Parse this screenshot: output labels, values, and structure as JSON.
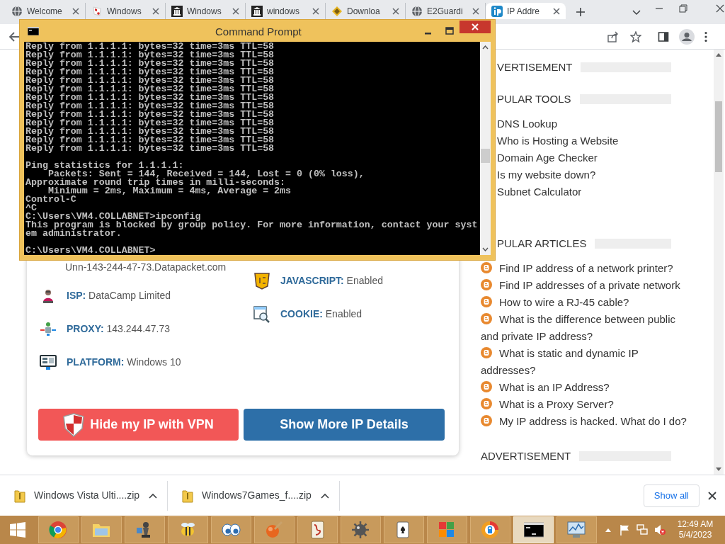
{
  "browser": {
    "tabs": [
      {
        "title": "Welcome",
        "kind": "globe",
        "selected": false
      },
      {
        "title": "Windows",
        "kind": "flag",
        "selected": false
      },
      {
        "title": "Windows",
        "kind": "building",
        "selected": false
      },
      {
        "title": "windows",
        "kind": "building",
        "selected": false
      },
      {
        "title": "Downloa",
        "kind": "diamond",
        "selected": false
      },
      {
        "title": "E2Guardi",
        "kind": "globe",
        "selected": false
      },
      {
        "title": "IP Addre",
        "kind": "logo",
        "selected": true
      }
    ]
  },
  "console": {
    "title": "Command Prompt",
    "lines": [
      {
        "text": "Reply from 1.1.1.1: bytes=32 time=3ms TTL=58"
      },
      {
        "text": "Reply from 1.1.1.1: bytes=32 time=3ms TTL=58"
      },
      {
        "text": "Reply from 1.1.1.1: bytes=32 time=3ms TTL=58"
      },
      {
        "text": "Reply from 1.1.1.1: bytes=32 time=3ms TTL=58"
      },
      {
        "text": "Reply from 1.1.1.1: bytes=32 time=3ms TTL=58"
      },
      {
        "text": "Reply from 1.1.1.1: bytes=32 time=3ms TTL=58"
      },
      {
        "text": "Reply from 1.1.1.1: bytes=32 time=3ms TTL=58"
      },
      {
        "text": "Reply from 1.1.1.1: bytes=32 time=3ms TTL=58"
      },
      {
        "text": "Reply from 1.1.1.1: bytes=32 time=3ms TTL=58"
      },
      {
        "text": "Reply from 1.1.1.1: bytes=32 time=3ms TTL=58"
      },
      {
        "text": "Reply from 1.1.1.1: bytes=32 time=3ms TTL=58"
      },
      {
        "text": "Reply from 1.1.1.1: bytes=32 time=3ms TTL=58"
      },
      {
        "text": "Reply from 1.1.1.1: bytes=32 time=3ms TTL=58"
      },
      {
        "text": "Ping statistics for 1.1.1.1:",
        "gap_before": true
      },
      {
        "text": "    Packets: Sent = 144, Received = 144, Lost = 0 (0% loss),"
      },
      {
        "text": "Approximate round trip times in milli-seconds:"
      },
      {
        "text": "    Minimum = 2ms, Maximum = 4ms, Average = 2ms"
      },
      {
        "text": "Control-C"
      },
      {
        "text": "^C"
      },
      {
        "text": "C:\\Users\\VM4.COLLABNET>ipconfig"
      },
      {
        "text": "This program is blocked by group policy. For more information, contact your syst"
      },
      {
        "text": "em administrator."
      },
      {
        "text": "C:\\Users\\VM4.COLLABNET>",
        "gap_before": true
      }
    ]
  },
  "page": {
    "hostname": "Unn-143-244-47-73.Datapacket.com",
    "info_left": [
      {
        "label": "ISP:",
        "value": "DataCamp Limited",
        "kind": "person"
      },
      {
        "label": "PROXY:",
        "value": "143.244.47.73",
        "kind": "network"
      },
      {
        "label": "PLATFORM:",
        "value": "Windows 10",
        "kind": "monitor"
      }
    ],
    "info_right": [
      {
        "label": "JAVASCRIPT:",
        "value": "Enabled",
        "kind": "js"
      },
      {
        "label": "COOKIE:",
        "value": "Enabled",
        "kind": "magnifier"
      }
    ],
    "buttons": [
      {
        "label": "Hide my IP with VPN",
        "kind": "vpn"
      },
      {
        "label": "Show More IP Details",
        "kind": "details"
      }
    ]
  },
  "sidebar": {
    "sections": [
      {
        "heading": "VERTISEMENT",
        "kind": "ad"
      },
      {
        "heading": "PULAR TOOLS",
        "kind": "tools",
        "items": [
          "DNS Lookup",
          "Who is Hosting a Website",
          "Domain Age Checker",
          "Is my website down?",
          "Subnet Calculator"
        ]
      },
      {
        "heading": "PULAR ARTICLES",
        "kind": "articles",
        "items": [
          "Find IP address of a network printer?",
          "Find IP addresses of a private network",
          "How to wire a RJ-45 cable?",
          "What is the difference between public and private IP address?",
          "What is static and dynamic IP addresses?",
          "What is an IP Address?",
          "What is a Proxy Server?",
          "My IP address is hacked. What do I do?"
        ]
      },
      {
        "heading": "ADVERTISEMENT",
        "kind": "ad"
      }
    ]
  },
  "downloads": {
    "items": [
      "Windows Vista Ulti....zip",
      "Windows7Games_f....zip"
    ],
    "show_all": "Show all"
  },
  "taskbar": {
    "apps": [
      {
        "kind": "browser",
        "selected": false
      },
      {
        "kind": "folder",
        "selected": false
      },
      {
        "kind": "chess",
        "selected": false
      },
      {
        "kind": "bee",
        "selected": false
      },
      {
        "kind": "eyes",
        "selected": false
      },
      {
        "kind": "paint",
        "selected": false
      },
      {
        "kind": "tile",
        "selected": false
      },
      {
        "kind": "mine",
        "selected": false
      },
      {
        "kind": "cards",
        "selected": false
      },
      {
        "kind": "blocks",
        "selected": false
      },
      {
        "kind": "ring",
        "selected": false
      },
      {
        "kind": "console",
        "selected": true
      },
      {
        "kind": "chart",
        "selected": false
      }
    ],
    "time": "12:49 AM",
    "date": "5/4/2023"
  }
}
